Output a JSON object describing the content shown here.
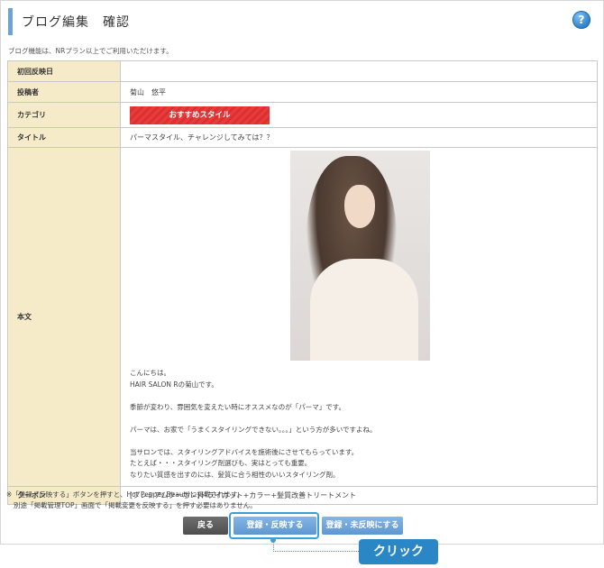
{
  "header": {
    "title": "ブログ編集　確認",
    "help_icon": "question-icon",
    "help_label": "?"
  },
  "notice": "ブログ機能は、NRプラン以上でご利用いただけます。",
  "form": {
    "first_publish_label": "初回反映日",
    "first_publish_value": "",
    "author_label": "投稿者",
    "author_value": "菊山　悠平",
    "category_label": "カテゴリ",
    "category_value": "おすすめスタイル",
    "title_label": "タイトル",
    "title_value": "パーマスタイル、チャレンジしてみては？？",
    "body_label": "本文",
    "body_lines": [
      "こんにちは。",
      "HAIR SALON Rの菊山です。",
      "",
      "季節が変わり、雰囲気を変えたい時にオススメなのが「パーマ」です。",
      "",
      "パーマは、お家で「うまくスタイリングできない。。。」という方が多いですよね。",
      "",
      "当サロンでは、スタイリングアドバイスを施術後にさせてもらっています。",
      "たとえば・・・スタイリング剤選びも、実はとっても重要。",
      "なりたい質感を出すのには、髪質に合う相性のいいスタイリング剤。"
    ],
    "coupon_label": "クーポン",
    "coupon_value": "[プレミアムクーポン]ドライカット+カラー+髪質改善トリートメント"
  },
  "footnote": {
    "line1": "※「登録・反映する」ボタンを押すと、Hot Pepper Beautyに掲載されます。",
    "line2": "別途「掲載管理TOP」画面で「掲載変更を反映する」を押す必要はありません。"
  },
  "buttons": {
    "back": "戻る",
    "register": "登録・反映する",
    "unpublish": "登録・未反映にする"
  },
  "annotation": {
    "click": "クリック"
  },
  "colors": {
    "label_bg": "#f6ebc9",
    "category_badge": "#e83b3b",
    "primary_button": "#5e97d0",
    "back_button": "#555555",
    "highlight": "#3aa0d9"
  }
}
